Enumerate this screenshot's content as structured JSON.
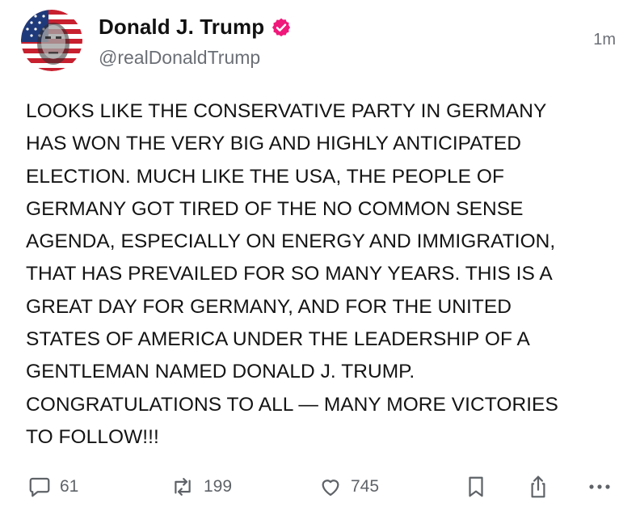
{
  "author": {
    "display_name": "Donald J. Trump",
    "handle": "@realDonaldTrump",
    "verified": true,
    "avatar_icon": "profile-photo-flag",
    "verified_color": "#f0187a"
  },
  "timestamp": "1m",
  "post": {
    "text": "LOOKS LIKE THE CONSERVATIVE PARTY IN GERMANY\nHAS WON THE VERY BIG AND HIGHLY ANTICIPATED\nELECTION. MUCH LIKE THE USA, THE PEOPLE OF\nGERMANY GOT TIRED OF THE NO COMMON SENSE\nAGENDA, ESPECIALLY ON ENERGY AND IMMIGRATION,\nTHAT HAS PREVAILED FOR SO MANY YEARS. THIS IS A\nGREAT DAY FOR GERMANY, AND FOR THE UNITED\nSTATES OF AMERICA UNDER THE LEADERSHIP OF A\nGENTLEMAN NAMED DONALD J. TRUMP.\nCONGRATULATIONS TO ALL — MANY MORE VICTORIES\nTO FOLLOW!!!"
  },
  "actions": {
    "replies": "61",
    "reposts": "199",
    "likes": "745",
    "icons": [
      "reply-icon",
      "repost-icon",
      "heart-icon",
      "bookmark-icon",
      "share-icon",
      "more-icon"
    ]
  }
}
